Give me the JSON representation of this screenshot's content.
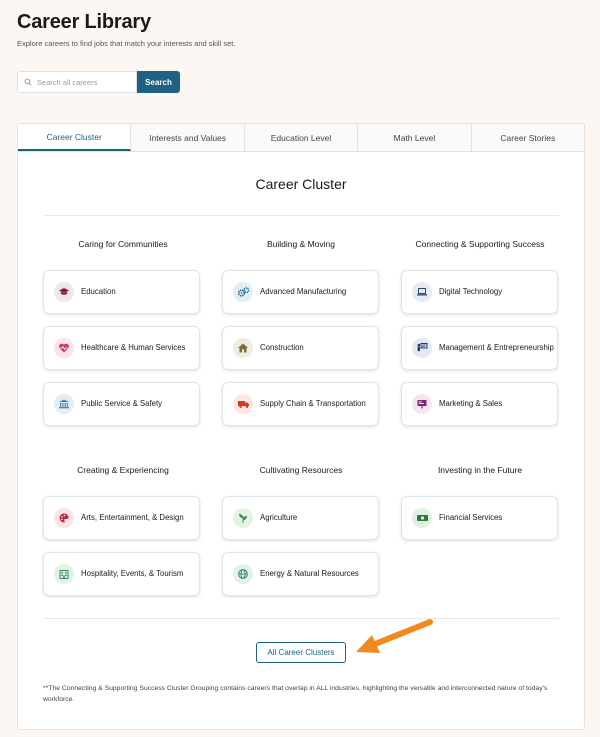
{
  "header": {
    "title": "Career Library",
    "subtitle": "Explore careers to find jobs that match your interests and skill set."
  },
  "search": {
    "placeholder": "Search all careers",
    "button_label": "Search"
  },
  "tabs": [
    {
      "label": "Career Cluster",
      "active": true
    },
    {
      "label": "Interests and Values",
      "active": false
    },
    {
      "label": "Education Level",
      "active": false
    },
    {
      "label": "Math Level",
      "active": false
    },
    {
      "label": "Career Stories",
      "active": false
    }
  ],
  "main": {
    "title": "Career Cluster",
    "groups": [
      {
        "heading": "Caring for Communities",
        "items": [
          {
            "label": "Education",
            "icon": "graduation-cap-icon",
            "color": "#8a1c3c"
          },
          {
            "label": "Healthcare & Human Services",
            "icon": "heart-pulse-icon",
            "color": "#c43a6a"
          },
          {
            "label": "Public Service & Safety",
            "icon": "government-building-icon",
            "color": "#4a7fa8"
          }
        ]
      },
      {
        "heading": "Building & Moving",
        "items": [
          {
            "label": "Advanced Manufacturing",
            "icon": "gears-icon",
            "color": "#1d6283"
          },
          {
            "label": "Construction",
            "icon": "house-icon",
            "color": "#7a6a3a"
          },
          {
            "label": "Supply Chain & Transportation",
            "icon": "truck-icon",
            "color": "#d03a2a"
          }
        ]
      },
      {
        "heading": "Connecting & Supporting Success",
        "items": [
          {
            "label": "Digital Technology",
            "icon": "laptop-icon",
            "color": "#2a4a6a"
          },
          {
            "label": "Management & Entrepreneurship",
            "icon": "presentation-icon",
            "color": "#1d3a6a"
          },
          {
            "label": "Marketing & Sales",
            "icon": "billboard-icon",
            "color": "#7a2a6a"
          }
        ]
      },
      {
        "heading": "Creating & Experiencing",
        "items": [
          {
            "label": "Arts, Entertainment, & Design",
            "icon": "palette-icon",
            "color": "#b82a3a"
          },
          {
            "label": "Hospitality, Events, & Tourism",
            "icon": "hotel-icon",
            "color": "#3a8a5a"
          }
        ]
      },
      {
        "heading": "Cultivating Resources",
        "items": [
          {
            "label": "Agriculture",
            "icon": "plant-icon",
            "color": "#3a8a4a"
          },
          {
            "label": "Energy & Natural Resources",
            "icon": "globe-leaf-icon",
            "color": "#2a7a6a"
          }
        ]
      },
      {
        "heading": "Investing in the Future",
        "items": [
          {
            "label": "Financial Services",
            "icon": "money-icon",
            "color": "#2a7a3a"
          }
        ]
      }
    ],
    "all_button_label": "All Career Clusters",
    "footnote": "**The Connecting & Supporting Success Cluster Grouping contains careers that overlap in ALL industries, highlighting the versatile and interconnected nature of today's workforce."
  },
  "annotation": {
    "color": "#f08a1c",
    "icon": "arrow-icon"
  }
}
